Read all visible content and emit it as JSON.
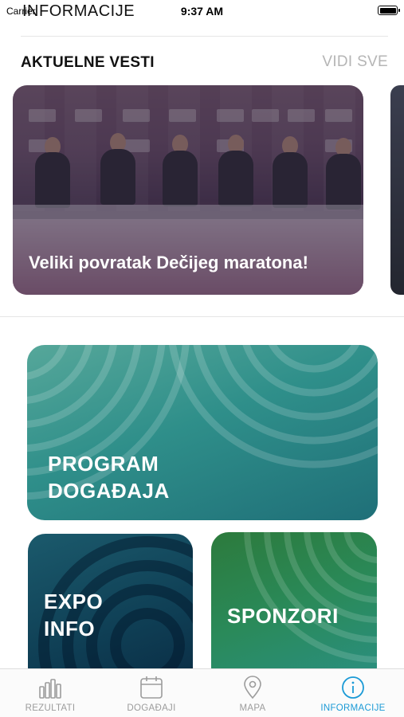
{
  "status_bar": {
    "carrier": "Carrier",
    "time": "9:37 AM"
  },
  "header": {
    "title": "INFORMACIJE"
  },
  "news": {
    "section_title": "AKTUELNE VESTI",
    "see_all": "VIDI SVE",
    "cards": [
      {
        "title": "Veliki povratak Dečijeg maratona!"
      }
    ]
  },
  "tiles": {
    "program": "PROGRAM\nDOGAĐAJA",
    "expo": "EXPO\nINFO",
    "sponsors": "SPONZORI"
  },
  "tab_bar": {
    "tabs": [
      {
        "label": "REZULTATI",
        "icon": "bar-chart-icon"
      },
      {
        "label": "DOGAĐAJI",
        "icon": "calendar-icon"
      },
      {
        "label": "MAPA",
        "icon": "map-pin-icon"
      },
      {
        "label": "INFORMACIJE",
        "icon": "info-icon",
        "active": true
      }
    ]
  },
  "colors": {
    "accent": "#1b9ad6",
    "inactive_tab": "#9c9c9c",
    "program_tile": "#2f8f8a",
    "expo_tile": "#0f3f55",
    "sponsor_tile": "#2a8a5a"
  }
}
